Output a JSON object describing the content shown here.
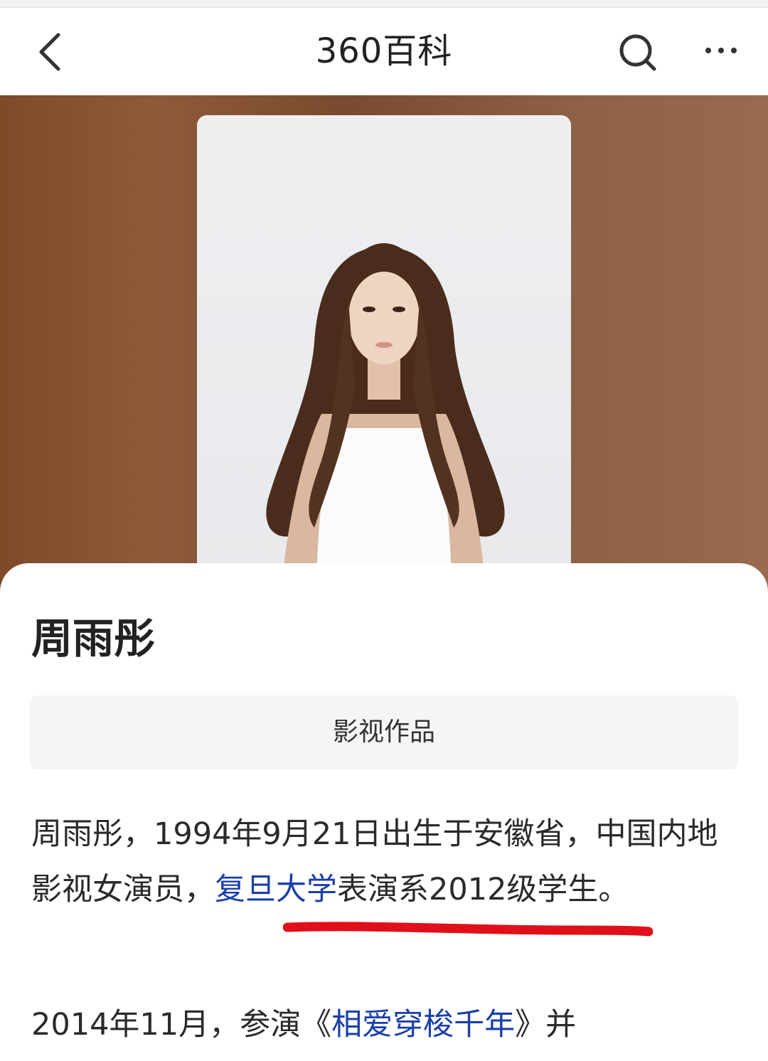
{
  "navbar": {
    "title": "360百科",
    "back_icon": "chevron-left-icon",
    "search_icon": "search-icon",
    "more_icon": "more-dots-icon"
  },
  "hero": {
    "background_color": "#8a5636",
    "photo_alt": "portrait photo"
  },
  "article": {
    "name": "周雨彤",
    "tab_label": "影视作品",
    "para1": {
      "before": "周雨彤，1994年9月21日出生于安徽省，中国内地影视女演员，",
      "link": "复旦大学",
      "after": "表演系2012级学生。"
    },
    "para2": {
      "before": "2014年11月，参演《",
      "link": "相爱穿梭千年",
      "after": "》并"
    }
  },
  "colors": {
    "link": "#1a3fa8",
    "annotation_underline": "#e0101a"
  }
}
